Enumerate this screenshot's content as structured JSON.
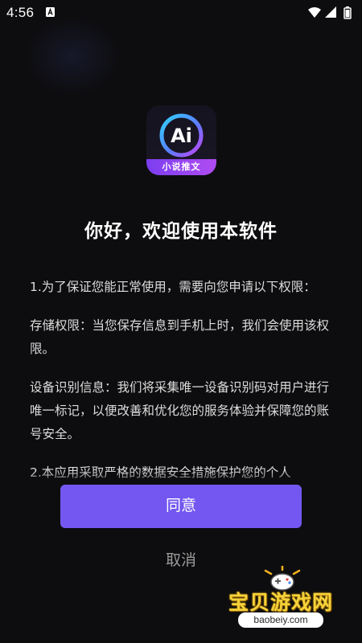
{
  "status_bar": {
    "time": "4:56",
    "icons": [
      "notification-a-icon",
      "wifi-icon",
      "cellular-icon",
      "battery-icon"
    ]
  },
  "app_icon": {
    "logo_text": "Ai",
    "banner_text": "小说推文",
    "colors": {
      "ring_start": "#2fd3ff",
      "ring_end": "#c444f5",
      "banner": "#8a42f0"
    }
  },
  "dialog": {
    "title": "你好，欢迎使用本软件",
    "paragraphs": [
      "1.为了保证您能正常使用，需要向您申请以下权限：",
      "存储权限：当您保存信息到手机上时，我们会使用该权限。",
      "设备识别信息：我们将采集唯一设备识别码对用户进行唯一标记，以便改善和优化您的服务体验并保障您的账号安全。",
      "2.本应用采取严格的数据安全措施保护您的个人"
    ],
    "agree_label": "同意",
    "cancel_label": "取消"
  },
  "watermark": {
    "text": "宝贝游戏网",
    "url": "baobeiy.com"
  },
  "colors": {
    "background": "#0d0d0f",
    "accent": "#7357f0",
    "text": "#dcdcdc",
    "cancel_text": "#9a9a9a"
  }
}
